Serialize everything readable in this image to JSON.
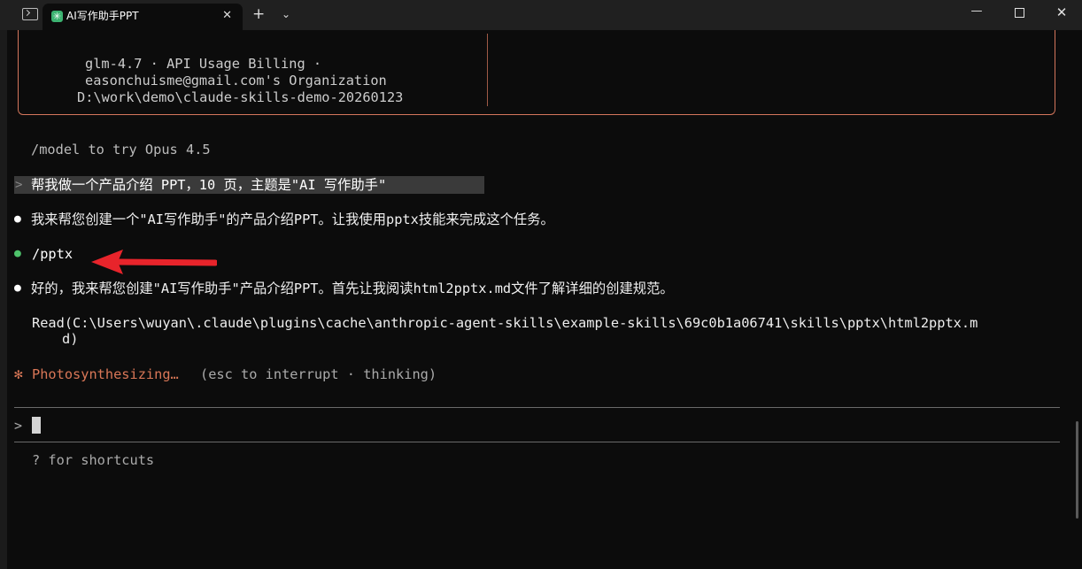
{
  "window": {
    "tab_title": "AI写作助手PPT",
    "tab_close": "✕",
    "new_tab": "+",
    "tab_dropdown": "⌄",
    "minimize": "—",
    "close": "✕"
  },
  "info_box": {
    "model_line": "glm-4.7 · API Usage Billing ·",
    "email_line": "easonchuisme@gmail.com's Organization",
    "path_line": "D:\\work\\demo\\claude-skills-demo-20260123"
  },
  "session": {
    "model_hint": "/model to try Opus 4.5",
    "user_prompt_marker": ">",
    "user_prompt": "帮我做一个产品介绍 PPT，10 页，主题是\"AI 写作助手\"",
    "bullet": "●",
    "reply_1": "我来帮您创建一个\"AI写作助手\"的产品介绍PPT。让我使用pptx技能来完成这个任务。",
    "command": "/pptx",
    "reply_2": "好的，我来帮您创建\"AI写作助手\"产品介绍PPT。首先让我阅读html2pptx.md文件了解详细的创建规范。",
    "read_line_1": "Read(C:\\Users\\wuyan\\.claude\\plugins\\cache\\anthropic-agent-skills\\example-skills\\69c0b1a06741\\skills\\pptx\\html2pptx.m",
    "read_line_2": "d)",
    "spinner": "✻",
    "status_word": "Photosynthesizing…",
    "status_hint": "(esc to interrupt · thinking)"
  },
  "input": {
    "prompt": ">",
    "shortcuts_hint": "? for shortcuts"
  },
  "colors": {
    "background": "#0c0c0c",
    "accent": "#d97757",
    "box_border": "#d4765c",
    "success_bullet": "#4ec36b",
    "annotation_arrow": "#e8242b"
  }
}
